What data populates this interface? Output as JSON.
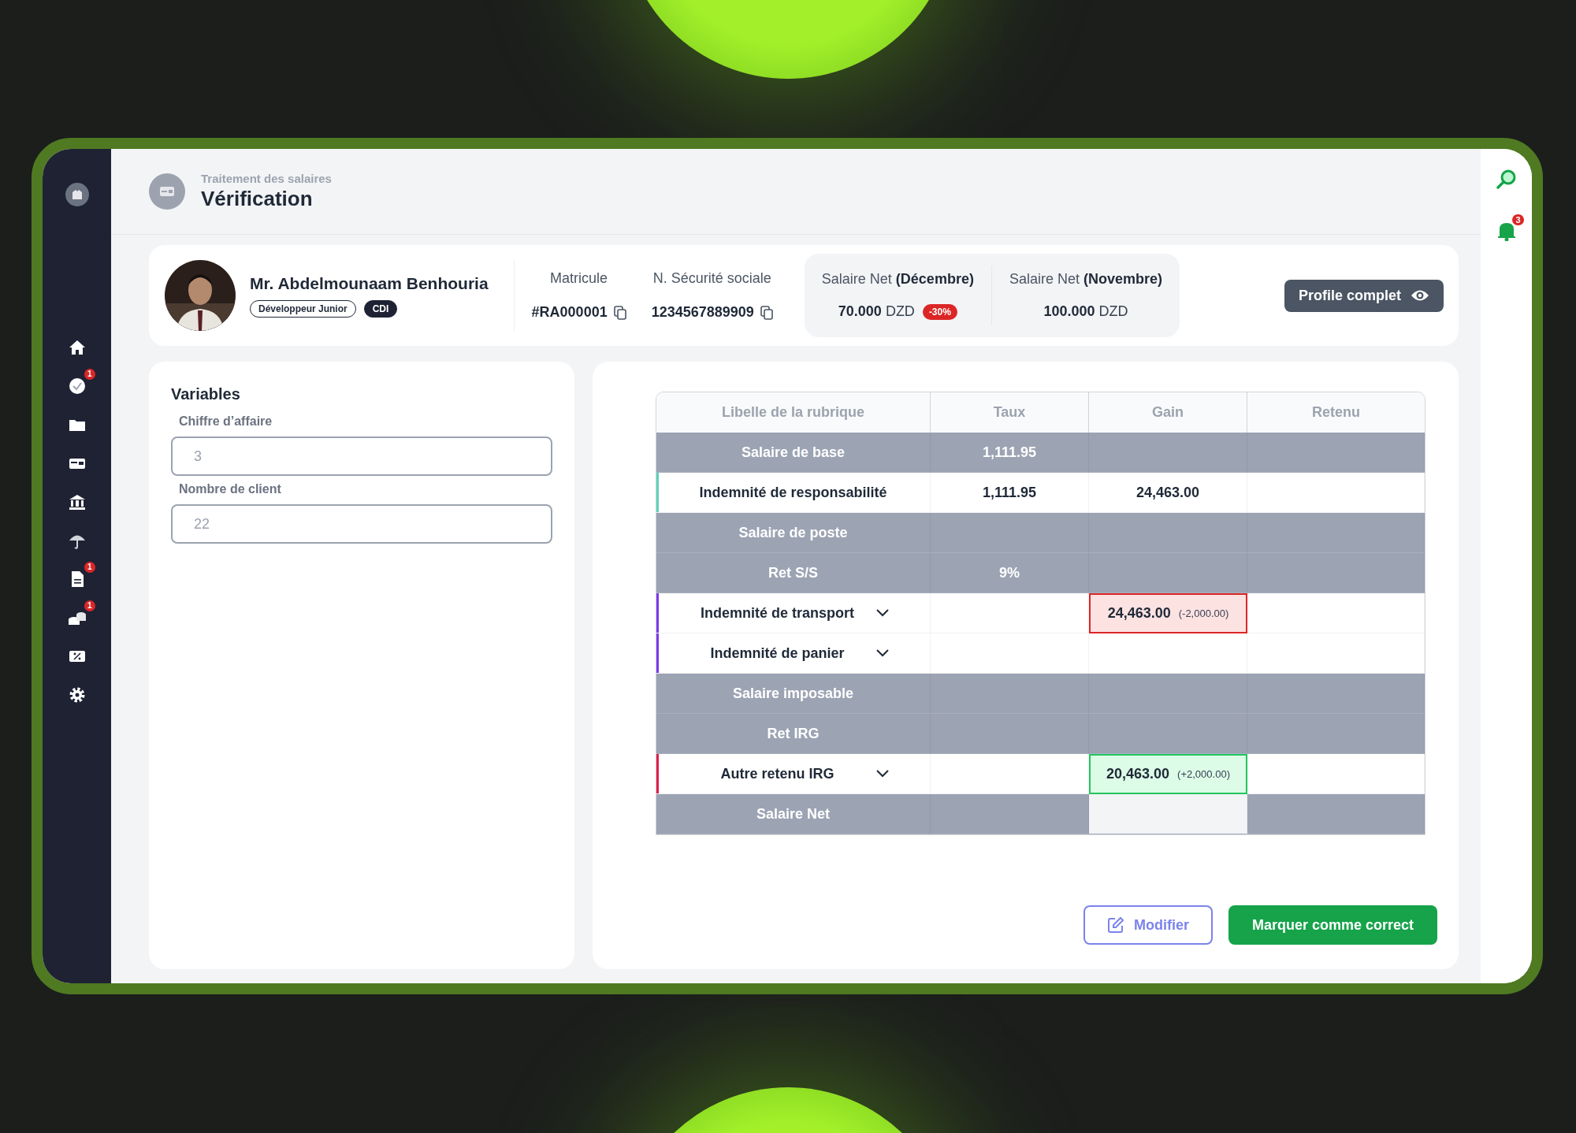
{
  "sidebar": {
    "items": [
      {
        "kind": "home"
      },
      {
        "kind": "check",
        "badge": "1"
      },
      {
        "kind": "folder"
      },
      {
        "kind": "card"
      },
      {
        "kind": "bank"
      },
      {
        "kind": "umbrella"
      },
      {
        "kind": "document",
        "badge": "1"
      },
      {
        "kind": "coins",
        "badge": "1"
      },
      {
        "kind": "percent"
      },
      {
        "kind": "gear"
      }
    ]
  },
  "header": {
    "breadcrumb": "Traitement des salaires",
    "title": "Vérification"
  },
  "rail": {
    "notifications": "3"
  },
  "profile": {
    "name": "Mr. Abdelmounaam Benhouria",
    "tags": [
      {
        "label": "Développeur Junior",
        "kind": "outline"
      },
      {
        "label": "CDI",
        "kind": "filled"
      }
    ],
    "ids": [
      {
        "label": "Matricule",
        "value": "#RA000001"
      },
      {
        "label": "N. Sécurité sociale",
        "value": "1234567889909"
      }
    ],
    "salaries": [
      {
        "label": "Salaire Net **(Décembre)**",
        "value": "**70.000** DZD",
        "badge": "-30%"
      },
      {
        "label": "Salaire Net **(Novembre)**",
        "value": "**100.000** DZD"
      }
    ],
    "button": "Profile complet"
  },
  "variables": {
    "title": "Variables",
    "fields": [
      {
        "label": "Chiffre d’affaire",
        "placeholder": "3"
      },
      {
        "label": "Nombre de client",
        "placeholder": "22"
      }
    ]
  },
  "table": {
    "columns": [
      "Libelle de la rubrique",
      "Taux",
      "Gain",
      "Retenu"
    ],
    "rows": [
      {
        "kind": "group",
        "label": "Salaire de base",
        "taux": "1,111.95"
      },
      {
        "kind": "item",
        "label": "Indemnité de responsabilité",
        "color": "#5fd3b8",
        "taux": "1,111.95",
        "gain": "24,463.00"
      },
      {
        "kind": "group",
        "label": "Salaire de poste"
      },
      {
        "kind": "group",
        "label": "Ret S/S",
        "taux": "9%"
      },
      {
        "kind": "item",
        "label": "Indemnité de transport",
        "color": "#7c3aed",
        "expandable": true,
        "gain": "24,463.00",
        "delta": "(-2,000.00)",
        "gain_decreased": true
      },
      {
        "kind": "item",
        "label": "Indemnité de panier",
        "color": "#7c3aed",
        "expandable": true
      },
      {
        "kind": "group",
        "label": "Salaire imposable"
      },
      {
        "kind": "group",
        "label": "Ret IRG"
      },
      {
        "kind": "item",
        "label": "Autre retenu IRG",
        "color": "#e11d48",
        "expandable": true,
        "gain": "20,463.00",
        "delta": "(+2,000.00)",
        "gain_increased": true
      },
      {
        "kind": "group",
        "label": "Salaire Net",
        "gain_blank": true
      }
    ]
  },
  "actions": [
    {
      "label": "Modifier",
      "kind": "secondary"
    },
    {
      "label": "Marquer comme correct",
      "kind": "primary"
    }
  ]
}
